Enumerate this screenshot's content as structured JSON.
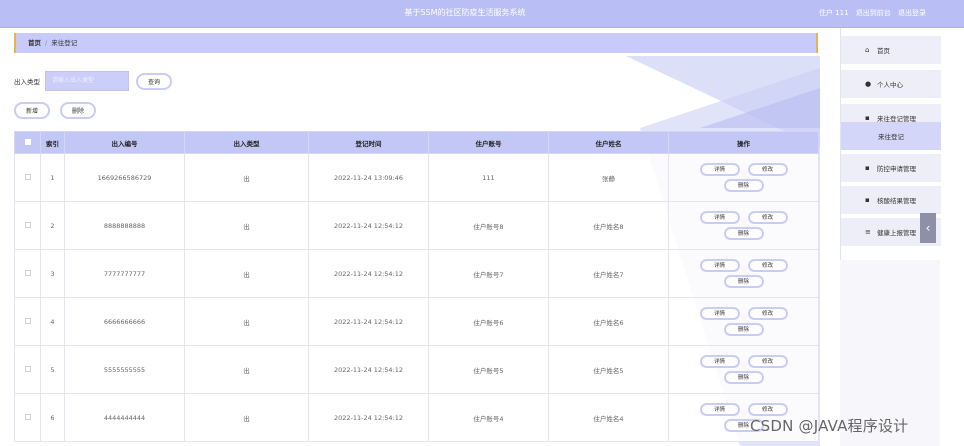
{
  "header": {
    "title": "基于SSM的社区防疫生活服务系统",
    "user": "住户 111",
    "backend_link": "退出到前台",
    "logout_link": "退出登录"
  },
  "breadcrumb": {
    "home": "首页",
    "separator": "/",
    "current": "来往登记"
  },
  "search": {
    "label": "出入类型",
    "placeholder": "请输入出入类型",
    "button": "查询"
  },
  "actions": {
    "add": "新增",
    "delete": "删除"
  },
  "table": {
    "columns": [
      "索引",
      "出入编号",
      "出入类型",
      "登记时间",
      "住户账号",
      "住户姓名",
      "操作"
    ],
    "row_actions": {
      "detail": "详情",
      "edit": "修改",
      "delete": "删除"
    },
    "rows": [
      {
        "index": "1",
        "code": "1669266586729",
        "type": "出",
        "time": "2022-11-24 13:09:46",
        "account": "111",
        "name": "张静"
      },
      {
        "index": "2",
        "code": "8888888888",
        "type": "出",
        "time": "2022-11-24 12:54:12",
        "account": "住户账号8",
        "name": "住户姓名8"
      },
      {
        "index": "3",
        "code": "7777777777",
        "type": "出",
        "time": "2022-11-24 12:54:12",
        "account": "住户账号7",
        "name": "住户姓名7"
      },
      {
        "index": "4",
        "code": "6666666666",
        "type": "出",
        "time": "2022-11-24 12:54:12",
        "account": "住户账号6",
        "name": "住户姓名6"
      },
      {
        "index": "5",
        "code": "5555555555",
        "type": "出",
        "time": "2022-11-24 12:54:12",
        "account": "住户账号5",
        "name": "住户姓名5"
      },
      {
        "index": "6",
        "code": "4444444444",
        "type": "出",
        "time": "2022-11-24 12:54:12",
        "account": "住户账号4",
        "name": "住户姓名4"
      }
    ]
  },
  "sidebar": {
    "items": [
      {
        "label": "首页",
        "icon": "home-icon",
        "glyph": "⌂"
      },
      {
        "label": "个人中心",
        "icon": "user-icon",
        "glyph": "●"
      },
      {
        "label": "来往登记管理",
        "icon": "grid-icon",
        "glyph": "▪"
      },
      {
        "label": "来往登记",
        "icon": "",
        "glyph": ""
      },
      {
        "label": "防控申请管理",
        "icon": "grid-icon",
        "glyph": "▪"
      },
      {
        "label": "核酸结果管理",
        "icon": "grid-icon",
        "glyph": "▪"
      },
      {
        "label": "健康上报管理",
        "icon": "menu-icon",
        "glyph": "≡"
      }
    ],
    "collapse_glyph": "‹"
  },
  "watermark": "CSDN @JAVA程序设计",
  "colors": {
    "accent": "#b9bef4",
    "header_row": "#c3c7f6",
    "breadcrumb_border": "#e8b34d"
  }
}
